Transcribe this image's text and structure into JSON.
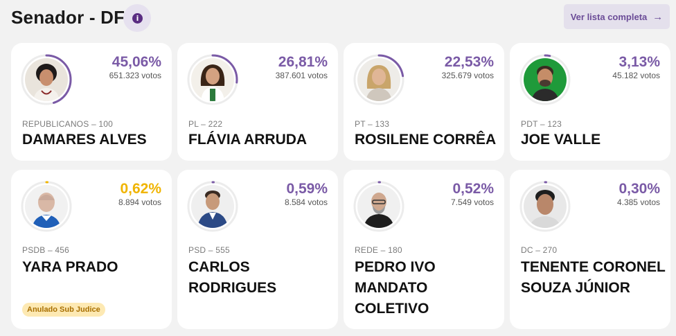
{
  "header": {
    "title": "Senador - DF",
    "info_icon": "i",
    "list_button": "Ver lista completa",
    "list_arrow": "→"
  },
  "colors": {
    "accent": "#7a5aa6",
    "accent_dark": "#5a2d82",
    "highlight": "#f0b400",
    "badge_bg": "#fde9b3",
    "badge_text": "#a86f00"
  },
  "candidates": [
    {
      "pct": "45,06%",
      "votes": "651.323 votos",
      "party": "REPUBLICANOS – 100",
      "name": "DAMARES ALVES",
      "share": 45.06,
      "icon": "candidate-photo"
    },
    {
      "pct": "26,81%",
      "votes": "387.601 votos",
      "party": "PL – 222",
      "name": "FLÁVIA ARRUDA",
      "share": 26.81,
      "icon": "candidate-photo"
    },
    {
      "pct": "22,53%",
      "votes": "325.679 votos",
      "party": "PT – 133",
      "name": "ROSILENE CORRÊA",
      "share": 22.53,
      "icon": "candidate-photo"
    },
    {
      "pct": "3,13%",
      "votes": "45.182 votos",
      "party": "PDT – 123",
      "name": "JOE VALLE",
      "share": 3.13,
      "icon": "candidate-photo"
    },
    {
      "pct": "0,62%",
      "votes": "8.894 votos",
      "party": "PSDB – 456",
      "name": "YARA PRADO",
      "share": 0.62,
      "badge": "Anulado Sub Judice",
      "icon": "candidate-photo"
    },
    {
      "pct": "0,59%",
      "votes": "8.584 votos",
      "party": "PSD – 555",
      "name": "CARLOS RODRIGUES",
      "share": 0.59,
      "icon": "candidate-photo"
    },
    {
      "pct": "0,52%",
      "votes": "7.549 votos",
      "party": "REDE – 180",
      "name": "PEDRO IVO MANDATO COLETIVO",
      "share": 0.52,
      "icon": "candidate-photo"
    },
    {
      "pct": "0,30%",
      "votes": "4.385 votos",
      "party": "DC – 270",
      "name": "TENENTE CORONEL SOUZA JÚNIOR",
      "share": 0.3,
      "icon": "candidate-photo"
    }
  ]
}
